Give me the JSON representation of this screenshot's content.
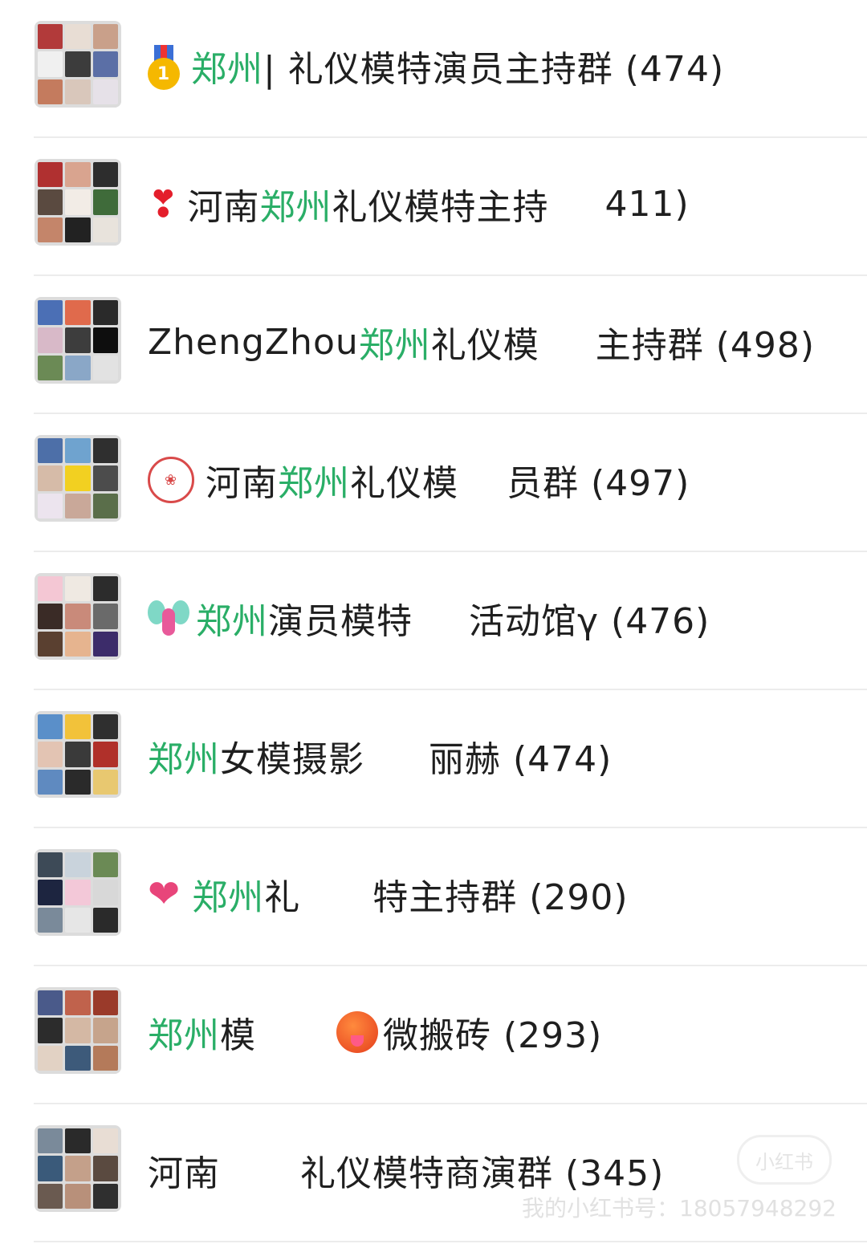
{
  "groups": [
    {
      "emoji": "medal-icon",
      "parts": [
        {
          "text": "郑州",
          "hl": true
        },
        {
          "text": " | 礼仪模特演员主持群 (474)",
          "hl": false
        }
      ],
      "tiles": [
        "#b23a3a",
        "#e8ddd4",
        "#c9a08a",
        "#f0f0f0",
        "#3c3c3c",
        "#5b6fa6",
        "#c47b5e",
        "#d9c7bb",
        "#e6e1e8"
      ]
    },
    {
      "emoji": "red-exclamation-heart-icon",
      "parts": [
        {
          "text": "河南 ",
          "hl": false
        },
        {
          "text": "郑州",
          "hl": true
        },
        {
          "text": "礼仪模特主持",
          "hl": false
        },
        {
          "text": "",
          "gap": 70
        },
        {
          "text": "411)",
          "hl": false
        }
      ],
      "tiles": [
        "#b03030",
        "#d9a48f",
        "#2d2d2d",
        "#5a4a40",
        "#f2ece6",
        "#3f6b3a",
        "#c4856a",
        "#222222",
        "#e8e3dc"
      ]
    },
    {
      "emoji": "",
      "parts": [
        {
          "text": "ZhengZhou ",
          "hl": false
        },
        {
          "text": "郑州",
          "hl": true
        },
        {
          "text": "礼仪模",
          "hl": false
        },
        {
          "text": "",
          "gap": 70
        },
        {
          "text": "主持群 (498)",
          "hl": false
        }
      ],
      "tiles": [
        "#4b6fb5",
        "#e06a4c",
        "#2a2a2a",
        "#d8b9c8",
        "#3d3d3d",
        "#0e0e0e",
        "#6b8a55",
        "#8aa7c7",
        "#e2e2e2"
      ]
    },
    {
      "emoji": "seal-icon",
      "parts": [
        {
          "text": "河南",
          "hl": false
        },
        {
          "text": "郑州",
          "hl": true
        },
        {
          "text": "礼仪模",
          "hl": false
        },
        {
          "text": "",
          "gap": 60
        },
        {
          "text": "员群 (497)",
          "hl": false
        }
      ],
      "tiles": [
        "#4d6fa8",
        "#6fa3cf",
        "#2f2f2f",
        "#d6bba8",
        "#f2d021",
        "#4c4c4c",
        "#ece4ee",
        "#c9a899",
        "#5a6e4a"
      ]
    },
    {
      "emoji": "fairy-icon",
      "parts": [
        {
          "text": "郑州",
          "hl": true
        },
        {
          "text": "演员模特",
          "hl": false
        },
        {
          "text": "",
          "gap": 70
        },
        {
          "text": "活动馆γ (476)",
          "hl": false
        }
      ],
      "tiles": [
        "#f4c7d4",
        "#efe9e2",
        "#2c2c2c",
        "#3a2b26",
        "#c98a7a",
        "#6a6a6a",
        "#5a4030",
        "#e6b48f",
        "#3c2c6a"
      ]
    },
    {
      "emoji": "",
      "parts": [
        {
          "text": "郑州",
          "hl": true
        },
        {
          "text": "女模摄影",
          "hl": false
        },
        {
          "text": "",
          "gap": 80
        },
        {
          "text": "丽赫 (474)",
          "hl": false
        }
      ],
      "tiles": [
        "#5a8fc9",
        "#f2c23a",
        "#2f2f2f",
        "#e3c4b3",
        "#3a3a3a",
        "#b0302a",
        "#5f8ac0",
        "#2a2a2a",
        "#e8c870"
      ]
    },
    {
      "emoji": "heart-arrow-icon",
      "parts": [
        {
          "text": "郑州",
          "hl": true
        },
        {
          "text": "礼",
          "hl": false
        },
        {
          "text": "",
          "gap": 90
        },
        {
          "text": "特主持群 (290)",
          "hl": false
        }
      ],
      "tiles": [
        "#3d4a57",
        "#c9d3dc",
        "#6b8a55",
        "#1d2540",
        "#f3c8d8",
        "#d8d8d8",
        "#7a8a9a",
        "#e6e6e6",
        "#2a2a2a"
      ]
    },
    {
      "emoji": "",
      "parts": [
        {
          "text": "郑州",
          "hl": true
        },
        {
          "text": "模",
          "hl": false
        },
        {
          "text": "",
          "gap": 100
        },
        {
          "text": "hot-face-icon",
          "icon": true
        },
        {
          "text": "微搬砖 (293)",
          "hl": false
        }
      ],
      "tiles": [
        "#4a5a8a",
        "#c0624c",
        "#9a3a2a",
        "#2c2c2c",
        "#d4b8a4",
        "#c6a48c",
        "#e2d2c4",
        "#3d5a7a",
        "#b47a5a"
      ]
    },
    {
      "emoji": "",
      "parts": [
        {
          "text": "河南",
          "hl": false
        },
        {
          "text": "",
          "gap": 100
        },
        {
          "text": "礼仪模特商演群 (345)",
          "hl": false
        }
      ],
      "tiles": [
        "#7a8a9a",
        "#2a2a2a",
        "#e8ddd4",
        "#3a5a7a",
        "#c4a08a",
        "#5a4a40",
        "#6a5a50",
        "#b8907a",
        "#2f2f2f"
      ]
    }
  ],
  "watermark": {
    "text": "我的小红书号：18057948292",
    "logo": "小红书"
  }
}
